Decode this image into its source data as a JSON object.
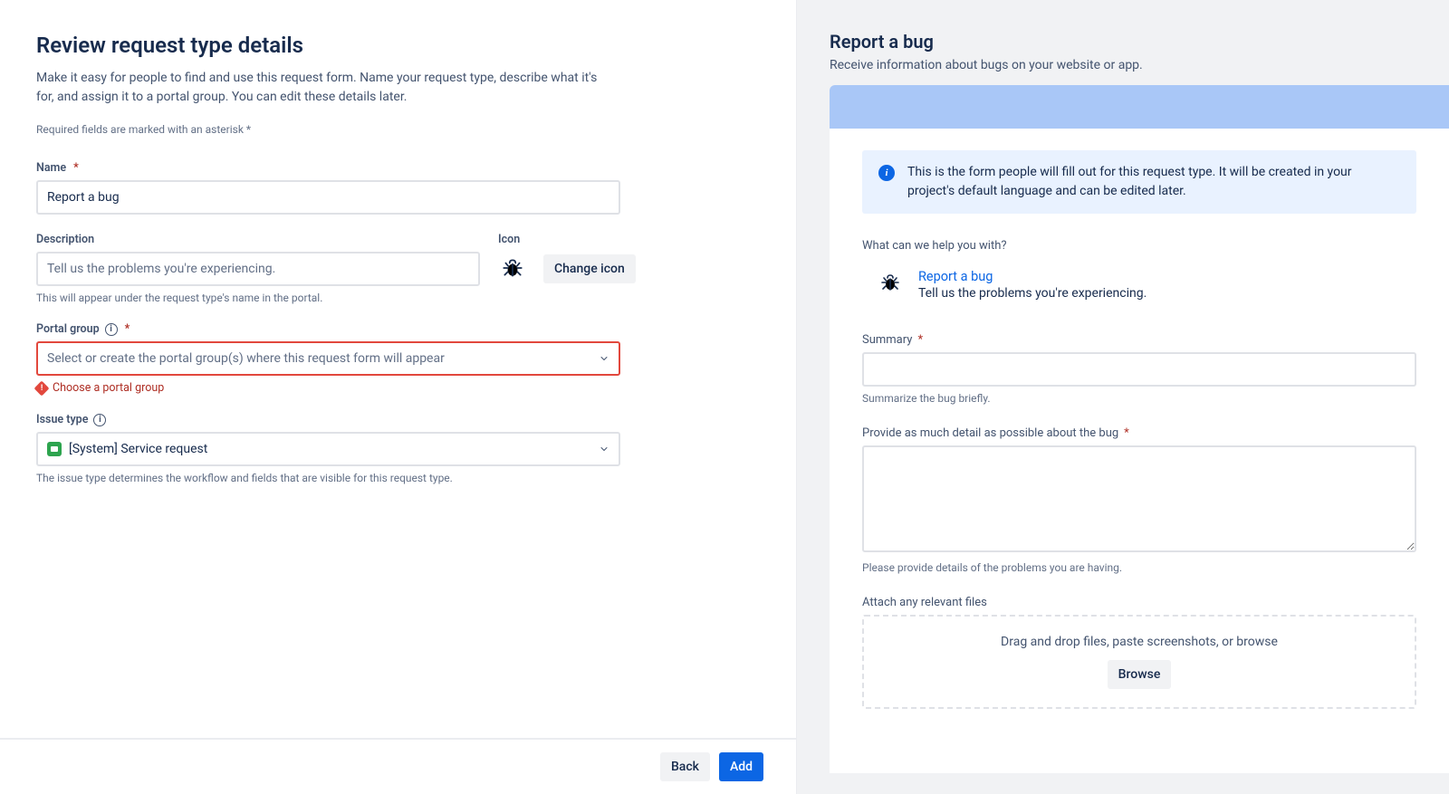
{
  "left": {
    "title": "Review request type details",
    "intro": "Make it easy for people to find and use this request form. Name your request type, describe what it's for, and assign it to a portal group. You can edit these details later.",
    "required_note": "Required fields are marked with an asterisk *",
    "name": {
      "label": "Name",
      "value": "Report a bug"
    },
    "description": {
      "label": "Description",
      "placeholder": "Tell us the problems you're experiencing.",
      "hint": "This will appear under the request type's name in the portal."
    },
    "icon": {
      "label": "Icon",
      "change_button": "Change icon"
    },
    "portal_group": {
      "label": "Portal group",
      "placeholder": "Select or create the portal group(s) where this request form will appear",
      "error": "Choose a portal group"
    },
    "issue_type": {
      "label": "Issue type",
      "value": "[System] Service request",
      "hint": "The issue type determines the workflow and fields that are visible for this request type."
    },
    "footer": {
      "back": "Back",
      "add": "Add"
    }
  },
  "right": {
    "title": "Report a bug",
    "subtitle": "Receive information about bugs on your website or app.",
    "info": "This is the form people will fill out for this request type. It will be created in your project's default language and can be edited later.",
    "help_heading": "What can we help you with?",
    "type_card": {
      "name": "Report a bug",
      "desc": "Tell us the problems you're experiencing."
    },
    "summary": {
      "label": "Summary",
      "hint": "Summarize the bug briefly."
    },
    "detail": {
      "label": "Provide as much detail as possible about the bug",
      "hint": "Please provide details of the problems you are having."
    },
    "attach": {
      "label": "Attach any relevant files",
      "dz_text": "Drag and drop files, paste screenshots, or browse",
      "browse": "Browse"
    }
  }
}
